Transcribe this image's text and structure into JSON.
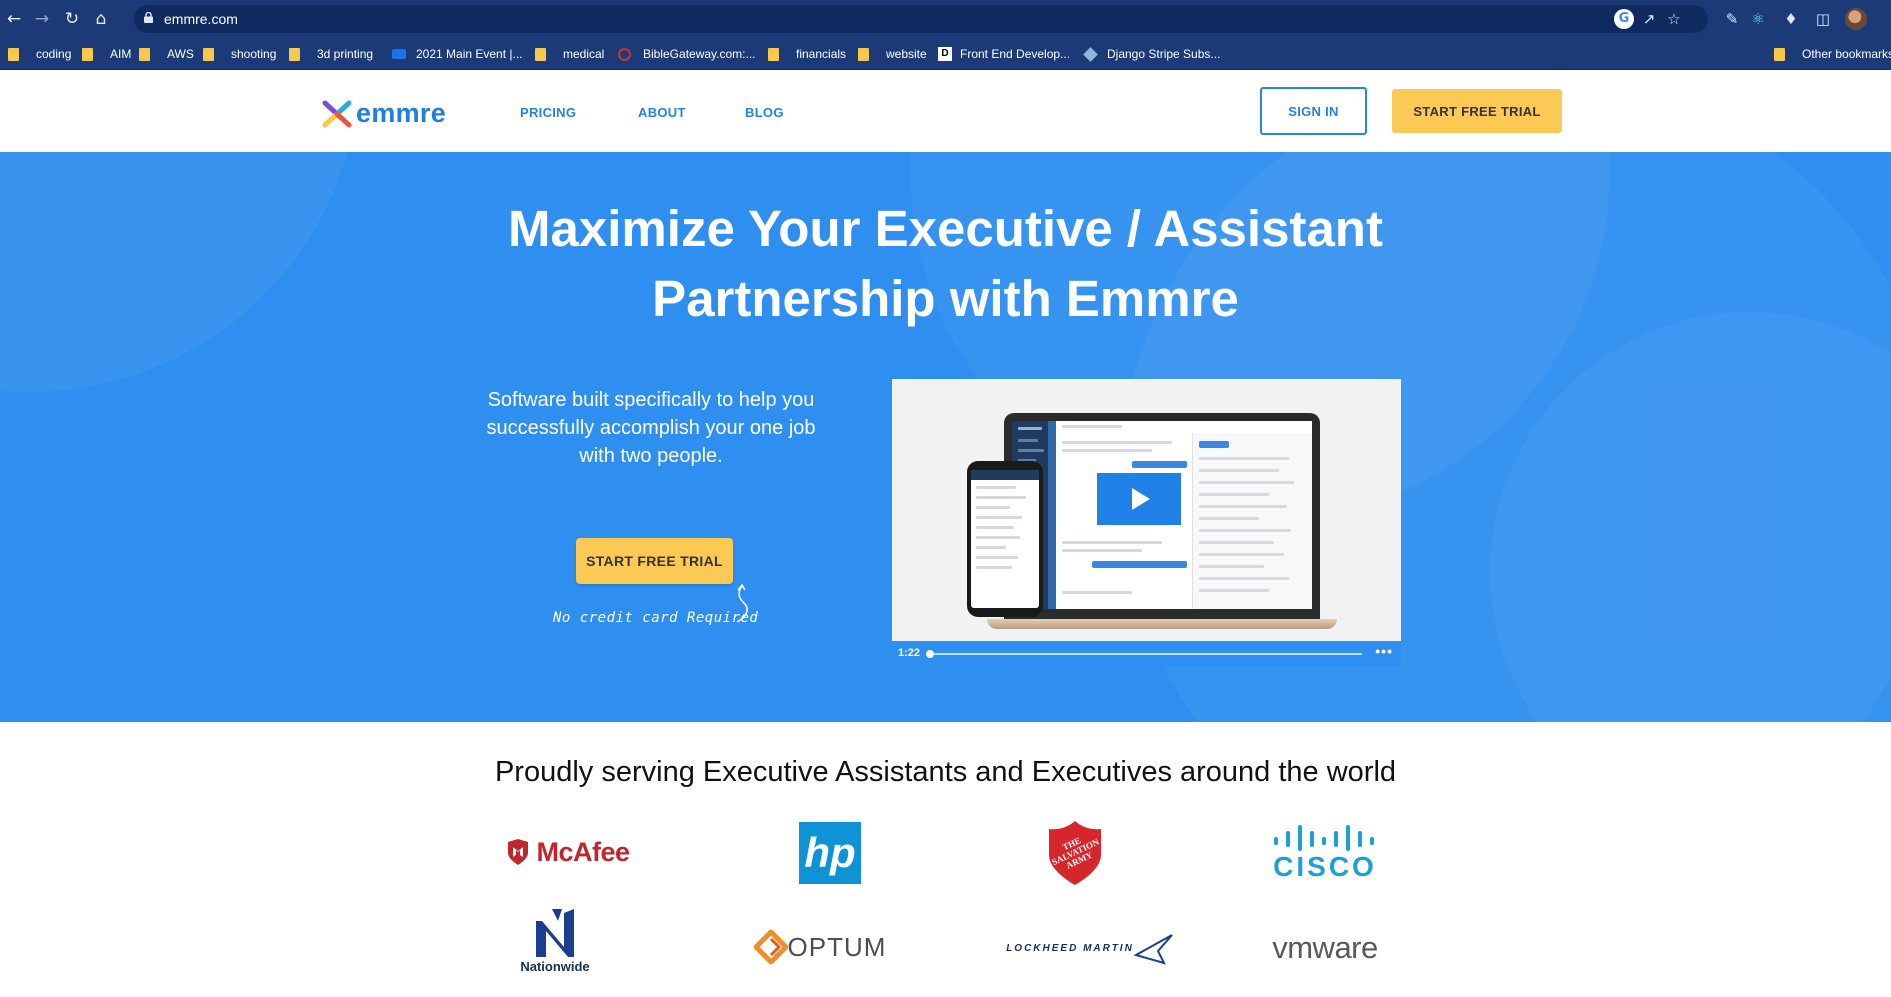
{
  "browser": {
    "url": "emmre.com",
    "bookmarks": [
      {
        "label": "coding",
        "icon": "folder-icon"
      },
      {
        "label": "AIM",
        "icon": "folder-icon"
      },
      {
        "label": "AWS",
        "icon": "folder-icon"
      },
      {
        "label": "shooting",
        "icon": "folder-icon"
      },
      {
        "label": "3d printing",
        "icon": "folder-icon"
      },
      {
        "label": "2021 Main Event |...",
        "icon": "event-favicon"
      },
      {
        "label": "medical",
        "icon": "folder-icon"
      },
      {
        "label": "BibleGateway.com:...",
        "icon": "biblegateway-favicon"
      },
      {
        "label": "financials",
        "icon": "folder-icon"
      },
      {
        "label": "website",
        "icon": "folder-icon"
      },
      {
        "label": "Front End Develop...",
        "icon": "d-favicon"
      },
      {
        "label": "Django Stripe Subs...",
        "icon": "cube-favicon"
      },
      {
        "label": "Other bookmarks",
        "icon": "folder-icon"
      }
    ]
  },
  "header": {
    "brand": "emmre",
    "nav": [
      "PRICING",
      "ABOUT",
      "BLOG"
    ],
    "sign_in": "SIGN IN",
    "start_trial": "START FREE TRIAL"
  },
  "hero": {
    "title_line1": "Maximize Your Executive / Assistant",
    "title_line2": "Partnership with Emmre",
    "subtitle": "Software built specifically to help you successfully accomplish your one job with two people.",
    "cta": "START FREE TRIAL",
    "note": "No credit card Required",
    "video": {
      "time": "1:22",
      "progress": 0.0
    }
  },
  "customers": {
    "title": "Proudly serving Executive Assistants and Executives around the world",
    "logos": [
      {
        "name": "McAfee",
        "text": "McAfee"
      },
      {
        "name": "HP",
        "text": "hp"
      },
      {
        "name": "The Salvation Army",
        "text": "THE SALVATION ARMY"
      },
      {
        "name": "Cisco",
        "text": "CISCO"
      },
      {
        "name": "Nationwide",
        "text": "Nationwide"
      },
      {
        "name": "Optum",
        "text": "OPTUM"
      },
      {
        "name": "Lockheed Martin",
        "text": "LOCKHEED MARTIN"
      },
      {
        "name": "VMware",
        "text": "vmware"
      }
    ]
  },
  "colors": {
    "brand_blue": "#2f8ff0",
    "cta_yellow": "#fcc955",
    "chrome": "#1c3a78"
  }
}
